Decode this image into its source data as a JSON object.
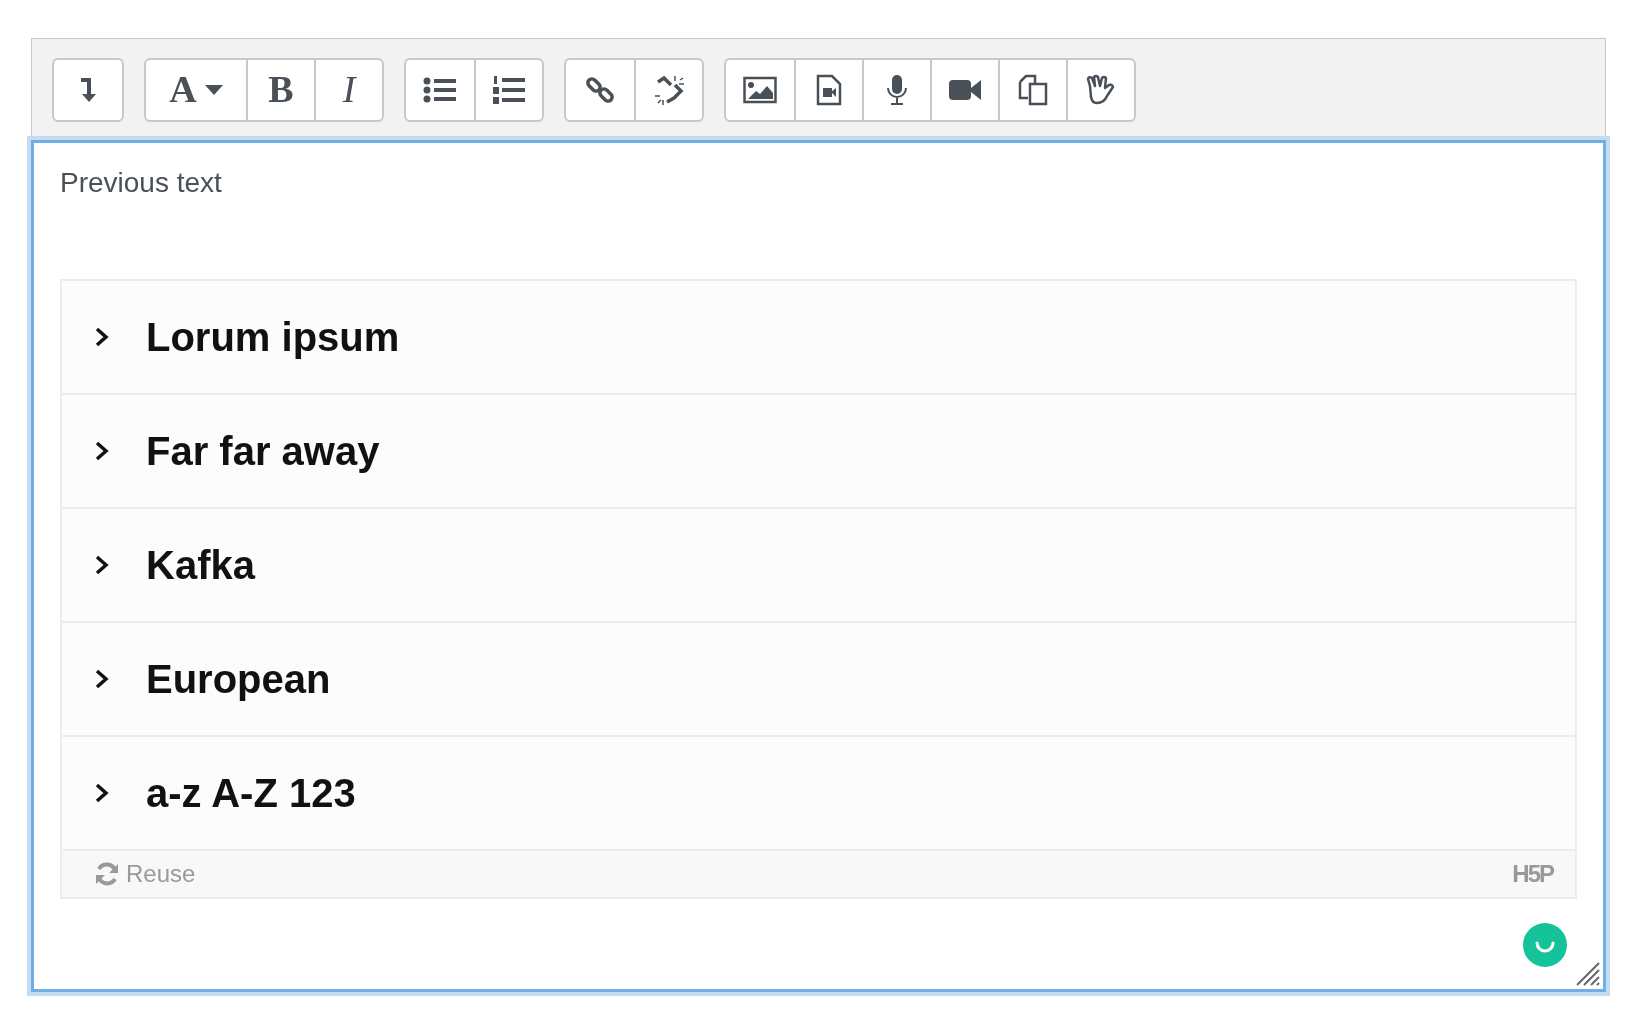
{
  "toolbar": {
    "groups": [
      [
        {
          "kind": "collapse"
        }
      ],
      [
        {
          "kind": "text",
          "label": "A",
          "dropdown": true
        },
        {
          "kind": "bold",
          "label": "B"
        },
        {
          "kind": "italic",
          "label": "I"
        }
      ],
      [
        {
          "kind": "bullets"
        },
        {
          "kind": "numbers"
        }
      ],
      [
        {
          "kind": "link"
        },
        {
          "kind": "unlink"
        }
      ],
      [
        {
          "kind": "image"
        },
        {
          "kind": "media"
        },
        {
          "kind": "mic"
        },
        {
          "kind": "video"
        },
        {
          "kind": "copy"
        },
        {
          "kind": "hand"
        }
      ]
    ]
  },
  "editor": {
    "intro": "Previous text",
    "accordion": [
      {
        "title": "Lorum ipsum",
        "expanded": false
      },
      {
        "title": "Far far away",
        "expanded": false
      },
      {
        "title": "Kafka",
        "expanded": false
      },
      {
        "title": "European",
        "expanded": false
      },
      {
        "title": "a-z A-Z 123",
        "expanded": false
      }
    ],
    "footer": {
      "reuse": "Reuse",
      "logo": "H5P"
    }
  }
}
